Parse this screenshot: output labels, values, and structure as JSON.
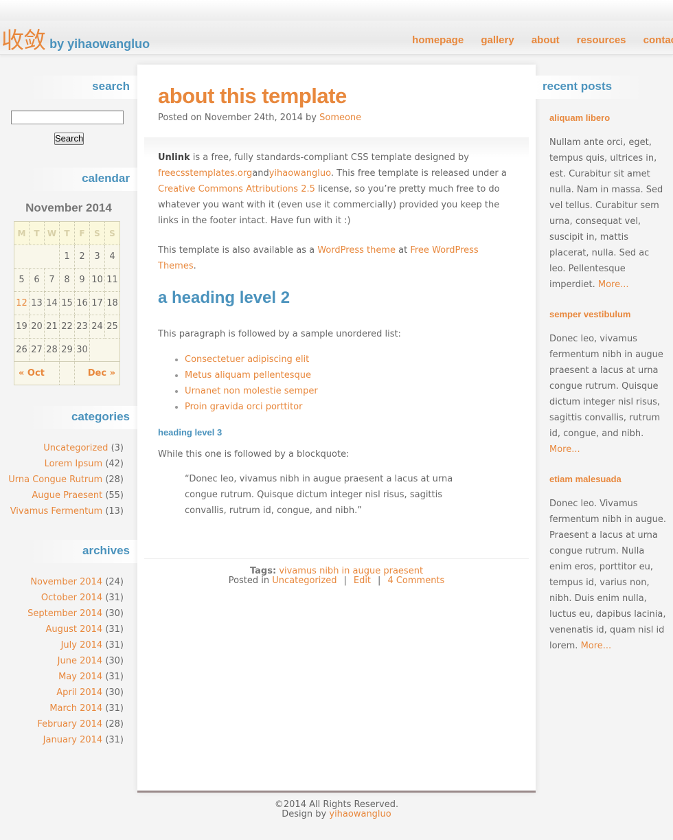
{
  "header": {
    "logo_text": "收敛",
    "logo_by": "by yihaowangluo",
    "nav": [
      "homepage",
      "gallery",
      "about",
      "resources",
      "contact"
    ]
  },
  "post": {
    "title": "about this template",
    "meta_prefix": "Posted on November 24th, 2014 by ",
    "author": "Someone",
    "intro": {
      "strong": "Unlink",
      "text1": " is a free, fully standards-compliant CSS template designed by ",
      "link1": "freecsstemplates.org",
      "and": "and",
      "link2": "yihaowangluo",
      "text2": ". This free template is released under a ",
      "link3": "Creative Commons Attributions 2.5",
      "text3": " license, so you’re pretty much free to do whatever you want with it (even use it commercially) provided you keep the links in the footer intact. Have fun with it :)"
    },
    "para2": {
      "text1": "This template is also available as a ",
      "link1": "WordPress theme",
      "text2": " at ",
      "link2": "Free WordPress Themes",
      "text3": "."
    },
    "h2": "a heading level 2",
    "list_intro": "This paragraph is followed by a sample unordered list:",
    "list_items": [
      "Consectetuer adipiscing elit",
      "Metus aliquam pellentesque",
      "Urnanet non molestie semper",
      "Proin gravida orci porttitor"
    ],
    "h3": "heading level 3",
    "quote_intro": "While this one is followed by a blockquote:",
    "blockquote": "“Donec leo, vivamus nibh in augue praesent a lacus at urna congue rutrum. Quisque dictum integer nisl risus, sagittis convallis, rutrum id, congue, and nibh.”",
    "tags_label": "Tags:",
    "tags": "vivamus nibh in augue praesent",
    "posted_in": "Posted in",
    "category": "Uncategorized",
    "separator": "|",
    "edit": "Edit",
    "comments": "4 Comments"
  },
  "footer": {
    "copyright": "©2014 All Rights Reserved.",
    "design_by": "Design by",
    "designer": "yihaowangluo"
  },
  "sidebar_left": {
    "search_heading": "search",
    "search_button": "Search",
    "search_value": "",
    "calendar_heading": "calendar",
    "calendar_caption": "November 2014",
    "weekdays": [
      "M",
      "T",
      "W",
      "T",
      "F",
      "S",
      "S"
    ],
    "weeks": [
      [
        "",
        "",
        "",
        "",
        "",
        "1",
        "2",
        "3",
        "4"
      ],
      [
        "5",
        "6",
        "7",
        "8",
        "9",
        "10",
        "11"
      ],
      [
        "12",
        "13",
        "14",
        "15",
        "16",
        "17",
        "18"
      ],
      [
        "19",
        "20",
        "21",
        "22",
        "23",
        "24",
        "25"
      ],
      [
        "26",
        "27",
        "28",
        "29",
        "30"
      ]
    ],
    "cal_prev": "« Oct",
    "cal_next": "Dec »",
    "categories_heading": "categories",
    "categories": [
      {
        "name": "Uncategorized",
        "count": "(3)"
      },
      {
        "name": "Lorem Ipsum",
        "count": "(42)"
      },
      {
        "name": "Urna Congue Rutrum",
        "count": "(28)"
      },
      {
        "name": "Augue Praesent",
        "count": "(55)"
      },
      {
        "name": "Vivamus Fermentum",
        "count": "(13)"
      }
    ],
    "archives_heading": "archives",
    "archives": [
      {
        "name": "November 2014",
        "count": "(24)"
      },
      {
        "name": "October 2014",
        "count": "(31)"
      },
      {
        "name": "September 2014",
        "count": "(30)"
      },
      {
        "name": "August 2014",
        "count": "(31)"
      },
      {
        "name": "July 2014",
        "count": "(31)"
      },
      {
        "name": "June 2014",
        "count": "(30)"
      },
      {
        "name": "May 2014",
        "count": "(31)"
      },
      {
        "name": "April 2014",
        "count": "(30)"
      },
      {
        "name": "March 2014",
        "count": "(31)"
      },
      {
        "name": "February 2014",
        "count": "(28)"
      },
      {
        "name": "January 2014",
        "count": "(31)"
      }
    ]
  },
  "sidebar_right": {
    "heading": "recent posts",
    "posts": [
      {
        "title": "aliquam libero",
        "body": "Nullam ante orci, eget, tempus quis, ultrices in, est. Curabitur sit amet nulla. Nam in massa. Sed vel tellus. Curabitur sem urna, consequat vel, suscipit in, mattis placerat, nulla. Sed ac leo. Pellentesque imperdiet.",
        "more": "More..."
      },
      {
        "title": "semper vestibulum",
        "body": "Donec leo, vivamus fermentum nibh in augue praesent a lacus at urna congue rutrum. Quisque dictum integer nisl risus, sagittis convallis, rutrum id, congue, and nibh.",
        "more": "More..."
      },
      {
        "title": "etiam malesuada",
        "body": "Donec leo. Vivamus fermentum nibh in augue. Praesent a lacus at urna congue rutrum. Nulla enim eros, porttitor eu, tempus id, varius non, nibh. Duis enim nulla, luctus eu, dapibus lacinia, venenatis id, quam nisl id lorem.",
        "more": "More..."
      }
    ]
  },
  "colors": {
    "accent_orange": "#e8883d",
    "accent_blue": "#4b93bd",
    "text": "#666666"
  }
}
